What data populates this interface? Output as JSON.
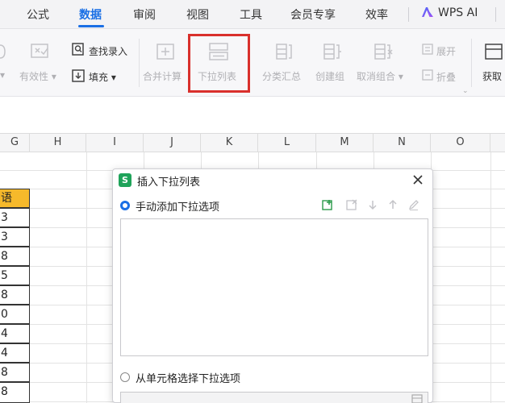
{
  "menu": {
    "items": [
      {
        "label": "公式"
      },
      {
        "label": "数据"
      },
      {
        "label": "审阅"
      },
      {
        "label": "视图"
      },
      {
        "label": "工具"
      },
      {
        "label": "会员专享"
      },
      {
        "label": "效率"
      }
    ],
    "active_index": 1,
    "ai_label": "WPS AI"
  },
  "toolbar": {
    "validity_label": "有效性",
    "find_entry_label": "查找录入",
    "fill_label": "填充",
    "merge_calc_label": "合并计算",
    "dropdown_list_label": "下拉列表",
    "subtotal_label": "分类汇总",
    "create_group_label": "创建组",
    "ungroup_label": "取消组合",
    "expand_label": "展开",
    "collapse_label": "折叠",
    "get_data_label": "获取"
  },
  "sheet": {
    "columns": [
      "G",
      "H",
      "I",
      "J",
      "K",
      "L",
      "M",
      "N",
      "O"
    ],
    "g_header_cell": "语",
    "g_cells": [
      "3",
      "3",
      "8",
      "5",
      "8",
      "0",
      "4",
      "4",
      "8",
      "8"
    ]
  },
  "dialog": {
    "app_icon": "S",
    "title": "插入下拉列表",
    "option_manual": "手动添加下拉选项",
    "option_from_cells": "从单元格选择下拉选项",
    "selected_option": "manual"
  },
  "colors": {
    "accent": "#1a6fe5",
    "highlight": "#d9302c",
    "cell_header": "#f6b92b",
    "app_green": "#1fa35a"
  }
}
